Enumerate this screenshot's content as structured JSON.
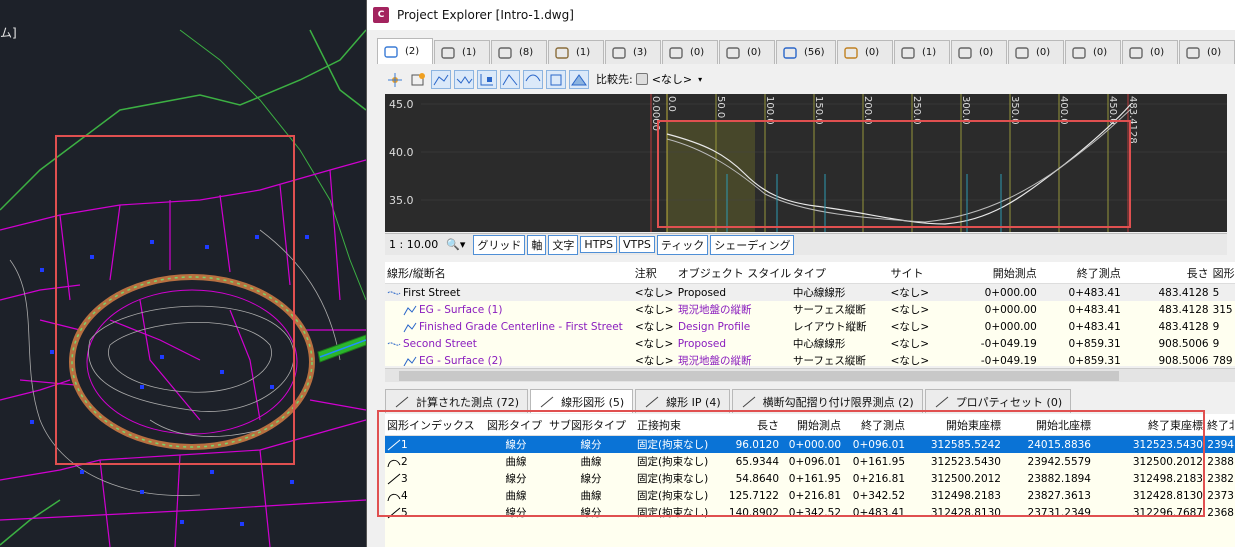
{
  "cad": {
    "label": "ム]"
  },
  "window": {
    "title": "Project Explorer [Intro-1.dwg]",
    "app_icon_text": "C"
  },
  "object_tabs": [
    {
      "label": "(2)",
      "icon": "alignment-icon"
    },
    {
      "label": "(1)",
      "icon": "building-icon"
    },
    {
      "label": "(8)",
      "icon": "profile-view-icon"
    },
    {
      "label": "(1)",
      "icon": "corridor-icon"
    },
    {
      "label": "(3)",
      "icon": "section-icon"
    },
    {
      "label": "(0)",
      "icon": "parcel-icon"
    },
    {
      "label": "(0)",
      "icon": "feature-line-icon"
    },
    {
      "label": "(56)",
      "icon": "pipe-icon"
    },
    {
      "label": "(0)",
      "icon": "surface-icon"
    },
    {
      "label": "(1)",
      "icon": "structure-icon"
    },
    {
      "label": "(0)",
      "icon": "structure2-icon"
    },
    {
      "label": "(0)",
      "icon": "sample-line-icon"
    },
    {
      "label": "(0)",
      "icon": "point-group-icon"
    },
    {
      "label": "(0)",
      "icon": "table-icon"
    },
    {
      "label": "(0)",
      "icon": "sheet-icon"
    }
  ],
  "toolbar": {
    "compare_label": "比較先:",
    "compare_value": "<なし>"
  },
  "profile": {
    "y_ticks": [
      "45.0",
      "40.0",
      "35.0"
    ],
    "x_ticks": [
      "0.0000",
      "0.0",
      "50.0",
      "100.0",
      "150.0",
      "200.0",
      "250.0",
      "300.0",
      "350.0",
      "400.0",
      "450.0",
      "483.4128"
    ]
  },
  "profile_bar": {
    "scale": "1 : 10.00",
    "buttons": [
      "グリッド",
      "軸",
      "文字",
      "HTPS",
      "VTPS",
      "ティック",
      "シェーディング"
    ]
  },
  "grid1": {
    "headers": [
      "線形/縦断名",
      "注釈",
      "オブジェクト スタイル",
      "タイプ",
      "サイト",
      "開始測点",
      "終了測点",
      "長さ",
      "図形"
    ],
    "rows": [
      {
        "name": "First Street",
        "note": "<なし>",
        "style": "Proposed",
        "type": "中心線線形",
        "site": "<なし>",
        "start": "0+000.00",
        "end": "0+483.41",
        "len": "483.4128",
        "fig": "5",
        "level": 0,
        "purple": false
      },
      {
        "name": "EG - Surface (1)",
        "note": "<なし>",
        "style": "現況地盤の縦断",
        "type": "サーフェス縦断",
        "site": "<なし>",
        "start": "0+000.00",
        "end": "0+483.41",
        "len": "483.4128",
        "fig": "315",
        "level": 1,
        "purple": true
      },
      {
        "name": "Finished Grade Centerline - First Street",
        "note": "<なし>",
        "style": "Design Profile",
        "type": "レイアウト縦断",
        "site": "<なし>",
        "start": "0+000.00",
        "end": "0+483.41",
        "len": "483.4128",
        "fig": "9",
        "level": 1,
        "purple": true
      },
      {
        "name": "Second Street",
        "note": "<なし>",
        "style": "Proposed",
        "type": "中心線線形",
        "site": "<なし>",
        "start": "-0+049.19",
        "end": "0+859.31",
        "len": "908.5006",
        "fig": "9",
        "level": 0,
        "purple": true
      },
      {
        "name": "EG - Surface (2)",
        "note": "<なし>",
        "style": "現況地盤の縦断",
        "type": "サーフェス縦断",
        "site": "<なし>",
        "start": "-0+049.19",
        "end": "0+859.31",
        "len": "908.5006",
        "fig": "789",
        "level": 1,
        "purple": true
      }
    ]
  },
  "bottom_tabs": [
    {
      "label": "計算された測点 (72)",
      "icon": "crosshair-icon"
    },
    {
      "label": "線形図形 (5)",
      "icon": "line-segment-icon"
    },
    {
      "label": "線形 IP (4)",
      "icon": "triangle-icon"
    },
    {
      "label": "横断勾配摺り付け限界測点 (2)",
      "icon": "superelevation-icon"
    },
    {
      "label": "プロパティセット (0)",
      "icon": "property-set-icon"
    }
  ],
  "grid2": {
    "headers": [
      "図形インデックス",
      "図形タイプ",
      "サブ図形タイプ",
      "正接拘束",
      "長さ",
      "開始測点",
      "終了測点",
      "開始東座標",
      "開始北座標",
      "終了東座標",
      "終了北"
    ],
    "rows": [
      {
        "idx": "1",
        "type": "線分",
        "sub": "線分",
        "con": "固定(拘束なし)",
        "len": "96.0120",
        "st": "0+000.00",
        "en": "0+096.01",
        "se": "312585.5242",
        "sn": "24015.8836",
        "ee": "312523.5430",
        "en2": "2394"
      },
      {
        "idx": "2",
        "type": "曲線",
        "sub": "曲線",
        "con": "固定(拘束なし)",
        "len": "65.9344",
        "st": "0+096.01",
        "en": "0+161.95",
        "se": "312523.5430",
        "sn": "23942.5579",
        "ee": "312500.2012",
        "en2": "2388"
      },
      {
        "idx": "3",
        "type": "線分",
        "sub": "線分",
        "con": "固定(拘束なし)",
        "len": "54.8640",
        "st": "0+161.95",
        "en": "0+216.81",
        "se": "312500.2012",
        "sn": "23882.1894",
        "ee": "312498.2183",
        "en2": "2382"
      },
      {
        "idx": "4",
        "type": "曲線",
        "sub": "曲線",
        "con": "固定(拘束なし)",
        "len": "125.7122",
        "st": "0+216.81",
        "en": "0+342.52",
        "se": "312498.2183",
        "sn": "23827.3613",
        "ee": "312428.8130",
        "en2": "2373"
      },
      {
        "idx": "5",
        "type": "線分",
        "sub": "線分",
        "con": "固定(拘束なし)",
        "len": "140.8902",
        "st": "0+342.52",
        "en": "0+483.41",
        "se": "312428.8130",
        "sn": "23731.2349",
        "ee": "312296.7687",
        "en2": "2368"
      }
    ]
  }
}
